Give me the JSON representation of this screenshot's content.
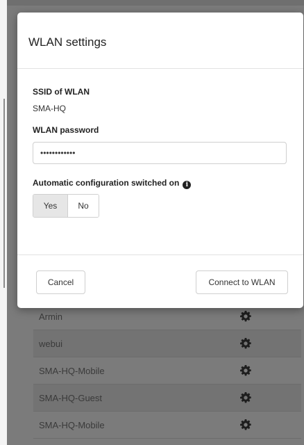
{
  "modal": {
    "title": "WLAN settings",
    "ssid_label": "SSID of WLAN",
    "ssid_value": "SMA-HQ",
    "password_label": "WLAN password",
    "password_value": "••••••••••••",
    "auto_config_label": "Automatic configuration switched on",
    "auto_config_options": [
      "Yes",
      "No"
    ],
    "auto_config_selected": "Yes",
    "cancel_label": "Cancel",
    "connect_label": "Connect to WLAN"
  },
  "networks": [
    {
      "name": "Armin"
    },
    {
      "name": "webui"
    },
    {
      "name": "SMA-HQ-Mobile"
    },
    {
      "name": "SMA-HQ-Guest"
    },
    {
      "name": "SMA-HQ-Mobile"
    }
  ],
  "icons": {
    "settings": "gear-icon",
    "info": "info-icon"
  }
}
